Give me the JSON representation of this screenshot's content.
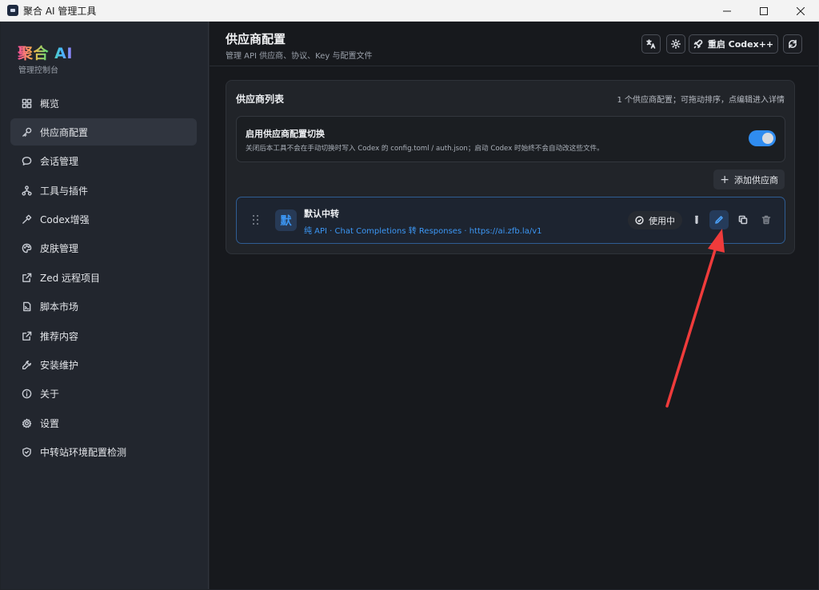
{
  "window": {
    "title": "聚合 AI 管理工具"
  },
  "brand": {
    "name": "聚合 AI",
    "subtitle": "管理控制台"
  },
  "sidebar": {
    "items": [
      {
        "label": "概览",
        "icon": "grid-icon"
      },
      {
        "label": "供应商配置",
        "icon": "key-icon",
        "active": true
      },
      {
        "label": "会话管理",
        "icon": "chat-icon"
      },
      {
        "label": "工具与插件",
        "icon": "network-icon"
      },
      {
        "label": "Codex增强",
        "icon": "hammer-icon"
      },
      {
        "label": "皮肤管理",
        "icon": "palette-icon"
      },
      {
        "label": "Zed 远程项目",
        "icon": "external-link-icon"
      },
      {
        "label": "脚本市场",
        "icon": "script-file-icon"
      },
      {
        "label": "推荐内容",
        "icon": "external-link-icon"
      },
      {
        "label": "安装维护",
        "icon": "wrench-icon"
      },
      {
        "label": "关于",
        "icon": "info-icon"
      },
      {
        "label": "设置",
        "icon": "gear-icon"
      },
      {
        "label": "中转站环境配置检测",
        "icon": "shield-icon"
      }
    ]
  },
  "header": {
    "title": "供应商配置",
    "subtitle": "管理 API 供应商、协议、Key 与配置文件",
    "restart_label": "重启 Codex++"
  },
  "card": {
    "title": "供应商列表",
    "note": "1 个供应商配置；可拖动排序，点编辑进入详情",
    "toggle": {
      "title": "启用供应商配置切换",
      "description": "关闭后本工具不会在手动切换时写入 Codex 的 config.toml / auth.json；启动 Codex 时始终不会自动改这些文件。",
      "enabled": true
    },
    "add_label": "添加供应商"
  },
  "providers": [
    {
      "avatar": "默",
      "name": "默认中转",
      "description": "纯 API · Chat Completions 转 Responses · https://ai.zfb.la/v1",
      "status": "使用中"
    }
  ],
  "colors": {
    "accent": "#2f8cf0",
    "link": "#3c97f5",
    "annotation_arrow": "#ef3b3b"
  }
}
